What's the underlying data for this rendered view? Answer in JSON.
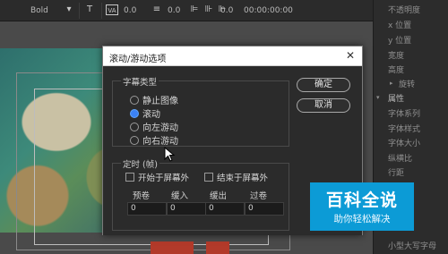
{
  "toolbar": {
    "font_style": "Bold",
    "value_1": "0.0",
    "value_2": "0.0",
    "value_3": "0.0",
    "timecode": "00:00:00:00"
  },
  "right_panel": {
    "items": [
      "不透明度",
      "x 位置",
      "y 位置",
      "宽度",
      "高度",
      "旋转",
      "属性",
      "字体系列",
      "字体样式",
      "字体大小",
      "纵横比",
      "行距"
    ],
    "bottom_item": "小型大写字母"
  },
  "dialog": {
    "title": "滚动/游动选项",
    "close_glyph": "✕",
    "caption_type": {
      "label": "字幕类型",
      "options": [
        {
          "label": "静止图像",
          "selected": false
        },
        {
          "label": "滚动",
          "selected": true
        },
        {
          "label": "向左游动",
          "selected": false
        },
        {
          "label": "向右游动",
          "selected": false
        }
      ]
    },
    "timing": {
      "label": "定时 (帧)",
      "start_offscreen": "开始于屏幕外",
      "end_offscreen": "结束于屏幕外",
      "fields": [
        {
          "label": "预卷",
          "value": "0"
        },
        {
          "label": "缓入",
          "value": "0"
        },
        {
          "label": "缓出",
          "value": "0"
        },
        {
          "label": "过卷",
          "value": "0"
        }
      ]
    },
    "ok_label": "确定",
    "cancel_label": "取消"
  },
  "watermark": {
    "main": "百科全说",
    "sub": "助你轻松解决"
  },
  "colors": {
    "accent": "#3b82f6",
    "watermark_bg": "#0c9bd6",
    "dialog_body": "#2b2b2b"
  }
}
